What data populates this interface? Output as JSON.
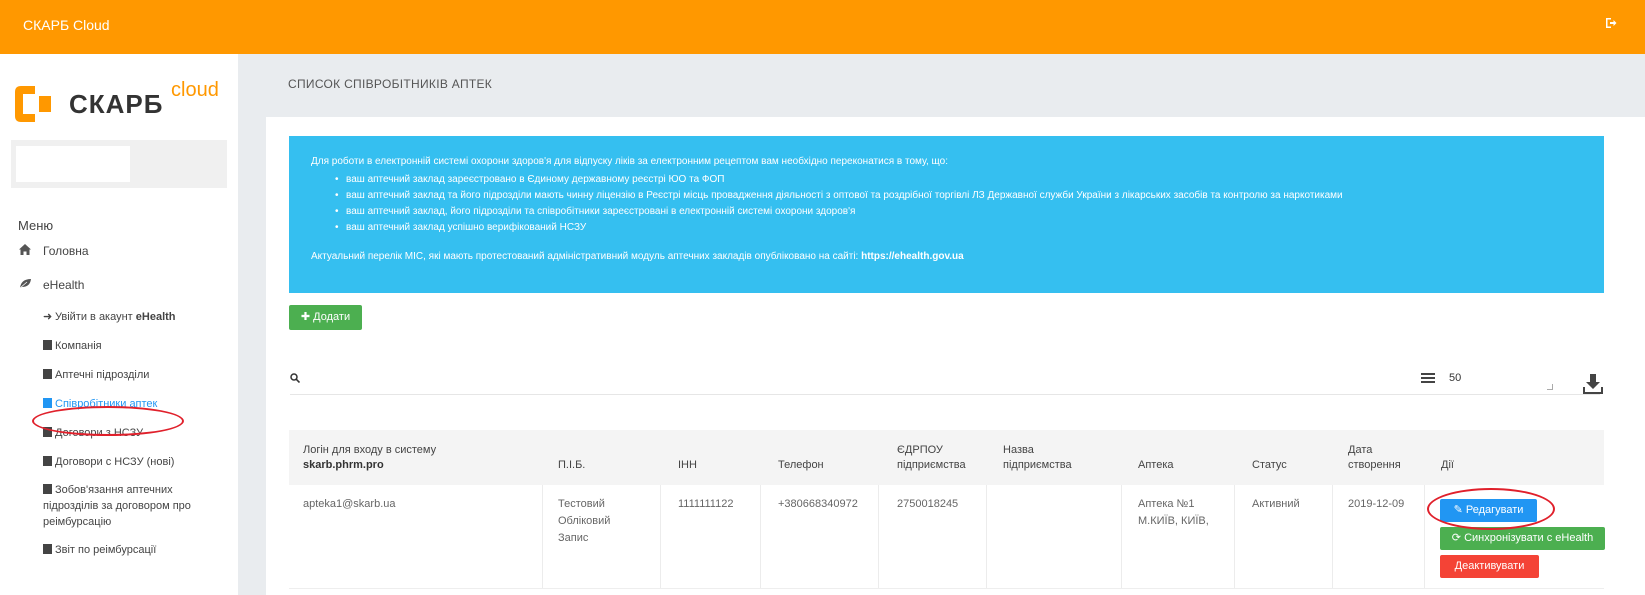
{
  "topbar": {
    "title": "СКАРБ Cloud",
    "logout_icon": "sign-out-icon"
  },
  "logo": {
    "word": "СКАРБ",
    "sup": "cloud"
  },
  "sidebar": {
    "menu_title": "Меню",
    "items": [
      {
        "label": "Головна",
        "icon": "home-icon"
      },
      {
        "label": "eHealth",
        "icon": "leaf-icon"
      }
    ],
    "subitems": [
      {
        "label": "Увійти в акаунт ",
        "bold": "eHealth",
        "icon": "sign-in-icon"
      },
      {
        "label": "Компанія",
        "icon": "database-icon"
      },
      {
        "label": "Аптечні підрозділи",
        "icon": "plus-square-icon"
      },
      {
        "label": "Співробітники аптек",
        "icon": "users-icon",
        "active": true
      },
      {
        "label": "Договори з НСЗУ",
        "icon": "file-icon"
      },
      {
        "label": "Договори с НСЗУ (нові)",
        "icon": "file-icon"
      },
      {
        "label": "Зобов'язання аптечних підрозділів за договором про реімбурсацію",
        "icon": "file-icon"
      },
      {
        "label": "Звіт по реімбурсації",
        "icon": "file-icon"
      }
    ]
  },
  "page": {
    "title": "СПИСОК СПІВРОБІТНИКІВ АПТЕК"
  },
  "info": {
    "intro": "Для роботи в електронній системі охорони здоров'я для відпуску ліків за електронним рецептом вам необхідно переконатися в тому, що:",
    "bullets": [
      "ваш аптечний заклад зареєстровано в Єдиному державному реєстрі ЮО та ФОП",
      "ваш аптечний заклад та його підрозділи мають чинну ліцензію в Реєстрі місць провадження діяльності з оптової та роздрібної торгівлі ЛЗ Державної служби України з лікарських засобів та контролю за наркотиками",
      "ваш аптечний заклад, його підрозділи та співробітники зареєстровані в електронній системі охорони здоров'я",
      "ваш аптечний заклад успішно верифікований НСЗУ"
    ],
    "footer_text": "Актуальний перелік МІС, які мають протестований адміністративний модуль аптечних закладів опубліковано на сайті: ",
    "footer_link": "https://ehealth.gov.ua"
  },
  "toolbar": {
    "add_label": "Додати",
    "per_page": "50",
    "search_icon": "search-icon",
    "download_icon": "download-icon",
    "list_icon": "list-icon"
  },
  "table": {
    "headers": {
      "login_line1": "Логін для входу в систему",
      "login_line2": "skarb.phrm.pro",
      "name": "П.І.Б.",
      "inn": "ІНН",
      "phone": "Телефон",
      "edrpou_1": "ЄДРПОУ",
      "edrpou_2": "підприємства",
      "company_1": "Назва",
      "company_2": "підприємства",
      "pharmacy": "Аптека",
      "status": "Статус",
      "date_1": "Дата",
      "date_2": "створення",
      "actions": "Дії"
    },
    "rows": [
      {
        "login": "apteka1@skarb.ua",
        "name_1": "Тестовий",
        "name_2": "Обліковий",
        "name_3": "Запис",
        "inn": "1111111122",
        "phone": "+380668340972",
        "edrpou": "2750018245",
        "company": "",
        "pharmacy_1": "Аптека №1",
        "pharmacy_2": "М.КИЇВ, КИЇВ,",
        "status": "Активний",
        "date": "2019-12-09",
        "edit_label": "Редагувати",
        "sync_label": "Синхронізувати с eHealth",
        "deactivate_label": "Деактивувати"
      }
    ]
  },
  "colors": {
    "topbar": "#ff9800",
    "info": "#35bff0",
    "add": "#4caf50",
    "edit": "#2196f3",
    "sync": "#4caf50",
    "deactivate": "#f44336",
    "annotation": "#e0202b"
  }
}
